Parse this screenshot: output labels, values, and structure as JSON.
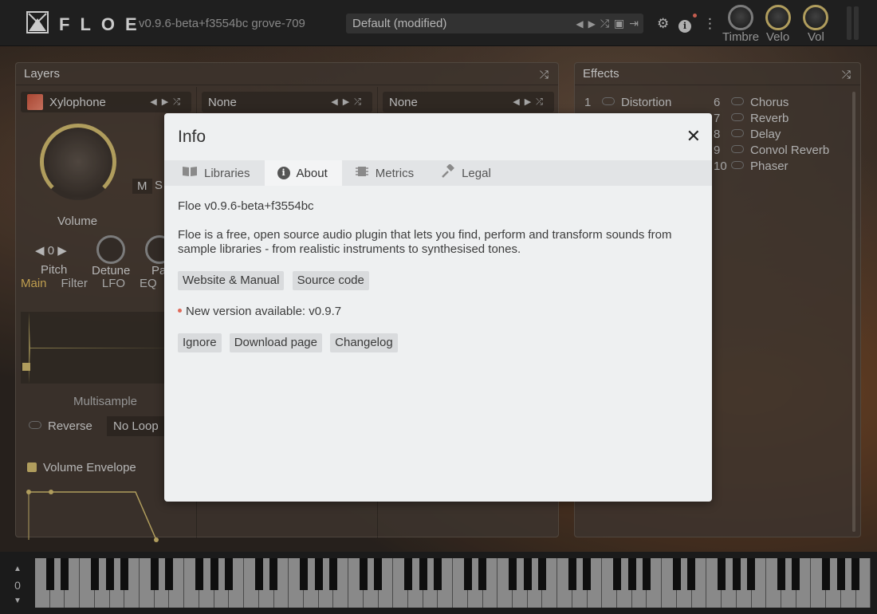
{
  "topbar": {
    "logo_text": "FLOE",
    "version": "v0.9.6-beta+f3554bc  grove-709",
    "preset_name": "Default (modified)",
    "knobs": [
      {
        "label": "Timbre"
      },
      {
        "label": "Velo"
      },
      {
        "label": "Vol"
      }
    ]
  },
  "layers_panel": {
    "title": "Layers",
    "layer1": {
      "instrument": "Xylophone",
      "volume_label": "Volume",
      "mute_label": "M",
      "solo_label": "S",
      "pitch_value": "0",
      "pitch_label": "Pitch",
      "detune_label": "Detune",
      "pan_label": "Pa",
      "tabs": [
        "Main",
        "Filter",
        "LFO",
        "EQ"
      ],
      "multisample_label": "Multisample",
      "reverse_label": "Reverse",
      "loop_label": "No Loop",
      "envelope_label": "Volume Envelope"
    },
    "layer2": {
      "instrument": "None"
    },
    "layer3": {
      "instrument": "None"
    }
  },
  "effects_panel": {
    "title": "Effects",
    "items_left": [
      {
        "num": "1",
        "name": "Distortion"
      }
    ],
    "items_right": [
      {
        "num": "6",
        "name": "Chorus"
      },
      {
        "num": "7",
        "name": "Reverb"
      },
      {
        "num": "8",
        "name": "Delay"
      },
      {
        "num": "9",
        "name": "Convol Reverb"
      },
      {
        "num": "10",
        "name": "Phaser"
      }
    ]
  },
  "keyboard": {
    "octave": "0"
  },
  "modal": {
    "title": "Info",
    "tabs": [
      {
        "label": "Libraries",
        "icon": "book-icon"
      },
      {
        "label": "About",
        "icon": "info-icon"
      },
      {
        "label": "Metrics",
        "icon": "chip-icon"
      },
      {
        "label": "Legal",
        "icon": "gavel-icon"
      }
    ],
    "active_tab": "About",
    "version_line": "Floe v0.9.6-beta+f3554bc",
    "description": "Floe is a free, open source audio plugin that lets you find, perform and transform sounds from sample libraries - from realistic instruments to synthesised tones.",
    "links": {
      "website": "Website & Manual",
      "source": "Source code"
    },
    "update_notice": "New version available: v0.9.7",
    "update_buttons": {
      "ignore": "Ignore",
      "download": "Download page",
      "changelog": "Changelog"
    }
  }
}
